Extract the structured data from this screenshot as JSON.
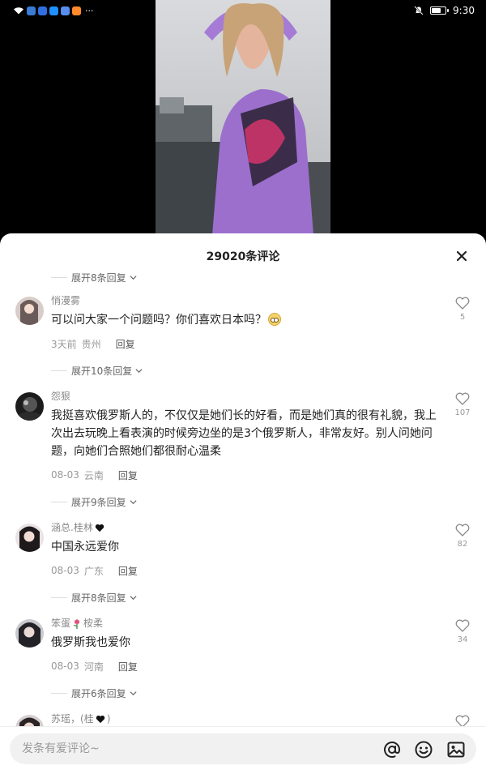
{
  "status_bar": {
    "time": "9:30",
    "more_indicator": "···",
    "left_icons": [
      "wifi-icon",
      "app-icon",
      "app-icon",
      "app-icon",
      "app-icon",
      "app-icon"
    ],
    "right_icons": [
      "notifications-muted-icon",
      "battery-icon"
    ],
    "battery_level": 0.7
  },
  "video": {
    "description_icons": [
      "video-thumbnail"
    ]
  },
  "comments_panel": {
    "title": "29020条评论",
    "close_icon": "close-icon",
    "top_expand": "展开8条回复",
    "comments": [
      {
        "name": "悄漫雾",
        "text": "可以问大家一个问题吗？你们喜欢日本吗？",
        "has_emoji": true,
        "time": "3天前",
        "location": "贵州",
        "reply": "回复",
        "likes": "5",
        "expand": "展开10条回复"
      },
      {
        "name": "怨狠",
        "text": "我挺喜欢俄罗斯人的，不仅仅是她们长的好看，而是她们真的很有礼貌，我上次出去玩晚上看表演的时候旁边坐的是3个俄罗斯人，非常友好。别人问她问题，向她们合照她们都很耐心温柔",
        "time": "08-03",
        "location": "云南",
        "reply": "回复",
        "likes": "107",
        "expand": "展开9条回复"
      },
      {
        "name": "涵总.桂林",
        "text": "中国永远爱你",
        "time": "08-03",
        "location": "广东",
        "reply": "回复",
        "likes": "82",
        "expand": "展开8条回复"
      },
      {
        "name": "笨蛋",
        "name_suffix": "桉柔",
        "text": "俄罗斯我也爱你",
        "time": "08-03",
        "location": "河南",
        "reply": "回复",
        "likes": "34",
        "expand": "展开6条回复"
      },
      {
        "name": "苏瑶，(桂",
        "name_suffix": ")"
      }
    ]
  },
  "input_bar": {
    "placeholder": "发条有爱评论~",
    "icons": [
      "mention-icon",
      "emoji-icon",
      "image-icon"
    ]
  },
  "colors": {
    "sheet_bg": "#ffffff",
    "text_primary": "#222222",
    "text_secondary": "#888888",
    "video_bg": "#000000"
  }
}
